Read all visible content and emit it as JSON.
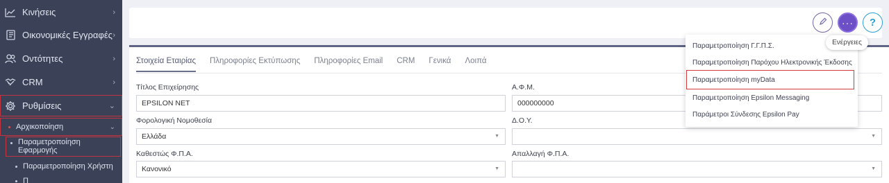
{
  "sidebar": {
    "items": [
      {
        "label": "Κινήσεις",
        "icon": "chart-icon"
      },
      {
        "label": "Οικονομικές Εγγραφές",
        "icon": "ledger-icon"
      },
      {
        "label": "Οντότητες",
        "icon": "users-icon"
      },
      {
        "label": "CRM",
        "icon": "handshake-icon"
      },
      {
        "label": "Ρυθμίσεις",
        "icon": "gear-icon"
      }
    ],
    "sub": {
      "init_label": "Αρχικοποίηση",
      "app_params_label": "Παραμετροποίηση Εφαρμογής",
      "user_params_label": "Παραμετροποίηση Χρήστη",
      "next_label": "Π"
    }
  },
  "tabs": [
    "Στοιχεία Εταιρίας",
    "Πληροφορίες Εκτύπωσης",
    "Πληροφορίες Email",
    "CRM",
    "Γενικά",
    "Λοιπά"
  ],
  "form": {
    "title_label": "Τίτλος Επιχείρησης",
    "title_value": "EPSILON NET",
    "afm_label": "Α.Φ.Μ.",
    "afm_value": "000000000",
    "tax_law_label": "Φορολογική Νομοθεσία",
    "tax_law_value": "Ελλάδα",
    "doy_label": "Δ.Ο.Υ.",
    "doy_value": "",
    "vat_status_label": "Καθεστώς Φ.Π.Α.",
    "vat_status_value": "Κανονικό",
    "vat_exempt_label": "Απαλλαγή Φ.Π.Α.",
    "vat_exempt_value": ""
  },
  "actions": {
    "edit_icon": "pencil-icon",
    "more_icon": "ellipsis-icon",
    "more_glyph": "···",
    "help_glyph": "?",
    "tooltip": "Ενέργειες"
  },
  "menu": [
    "Παραμετροποίηση Γ.Γ.Π.Σ.",
    "Παραμετροποίηση Παρόχου Ηλεκτρονικής Έκδοσης",
    "Παραμετροποίηση myData",
    "Παραμετροποίηση Epsilon Messaging",
    "Παράμετροι Σύνδεσης Epsilon Pay"
  ],
  "colors": {
    "sidebar_bg": "#3b4157",
    "accent": "#6d4fc7",
    "help": "#2a9fd6",
    "highlight": "#c2343f"
  }
}
